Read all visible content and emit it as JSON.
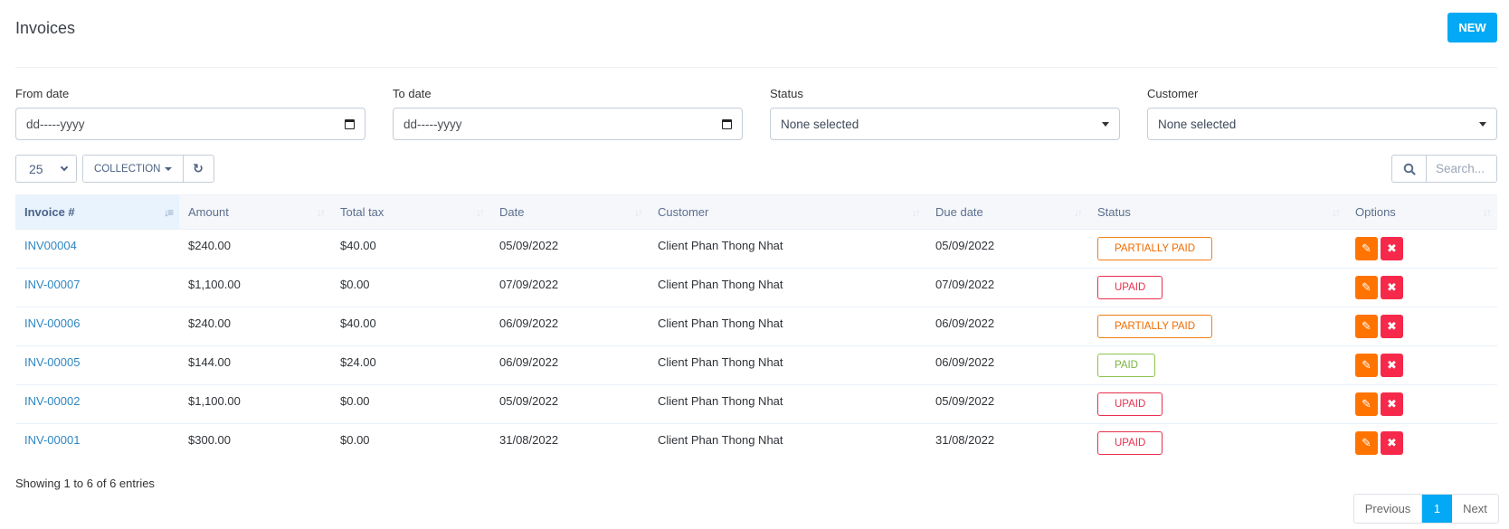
{
  "header": {
    "title": "Invoices",
    "new_button": "NEW"
  },
  "colors": {
    "accent": "#03a9f4",
    "edit": "#ff7400",
    "delete": "#f7294a",
    "partial": "#ef6c00",
    "unpaid": "#e9304e",
    "paid": "#7cb342"
  },
  "filters": {
    "from_date": {
      "label": "From date",
      "placeholder": "dd-----yyyy",
      "icon": "calendar-icon"
    },
    "to_date": {
      "label": "To date",
      "placeholder": "dd-----yyyy",
      "icon": "calendar-icon"
    },
    "status": {
      "label": "Status",
      "value": "None selected",
      "icon": "caret-down-icon"
    },
    "customer": {
      "label": "Customer",
      "value": "None selected",
      "icon": "caret-down-icon"
    }
  },
  "toolbar": {
    "page_length": "25",
    "collection_label": "COLLECTION",
    "refresh_icon": "refresh-icon",
    "search_icon": "search-icon",
    "search_placeholder": "Search..."
  },
  "table": {
    "columns": [
      "Invoice #",
      "Amount",
      "Total tax",
      "Date",
      "Customer",
      "Due date",
      "Status",
      "Options"
    ],
    "sorted_column": "Invoice #",
    "rows": [
      {
        "invoice": "INV00004",
        "amount": "$240.00",
        "tax": "$40.00",
        "date": "05/09/2022",
        "customer": "Client Phan Thong Nhat",
        "due": "05/09/2022",
        "status": "PARTIALLY PAID",
        "status_type": "partial"
      },
      {
        "invoice": "INV-00007",
        "amount": "$1,100.00",
        "tax": "$0.00",
        "date": "07/09/2022",
        "customer": "Client Phan Thong Nhat",
        "due": "07/09/2022",
        "status": "UPAID",
        "status_type": "unpaid"
      },
      {
        "invoice": "INV-00006",
        "amount": "$240.00",
        "tax": "$40.00",
        "date": "06/09/2022",
        "customer": "Client Phan Thong Nhat",
        "due": "06/09/2022",
        "status": "PARTIALLY PAID",
        "status_type": "partial"
      },
      {
        "invoice": "INV-00005",
        "amount": "$144.00",
        "tax": "$24.00",
        "date": "06/09/2022",
        "customer": "Client Phan Thong Nhat",
        "due": "06/09/2022",
        "status": "PAID",
        "status_type": "paid"
      },
      {
        "invoice": "INV-00002",
        "amount": "$1,100.00",
        "tax": "$0.00",
        "date": "05/09/2022",
        "customer": "Client Phan Thong Nhat",
        "due": "05/09/2022",
        "status": "UPAID",
        "status_type": "unpaid"
      },
      {
        "invoice": "INV-00001",
        "amount": "$300.00",
        "tax": "$0.00",
        "date": "31/08/2022",
        "customer": "Client Phan Thong Nhat",
        "due": "31/08/2022",
        "status": "UPAID",
        "status_type": "unpaid"
      }
    ]
  },
  "footer": {
    "info": "Showing 1 to 6 of 6 entries",
    "pagination": {
      "previous": "Previous",
      "current": "1",
      "next": "Next"
    }
  }
}
